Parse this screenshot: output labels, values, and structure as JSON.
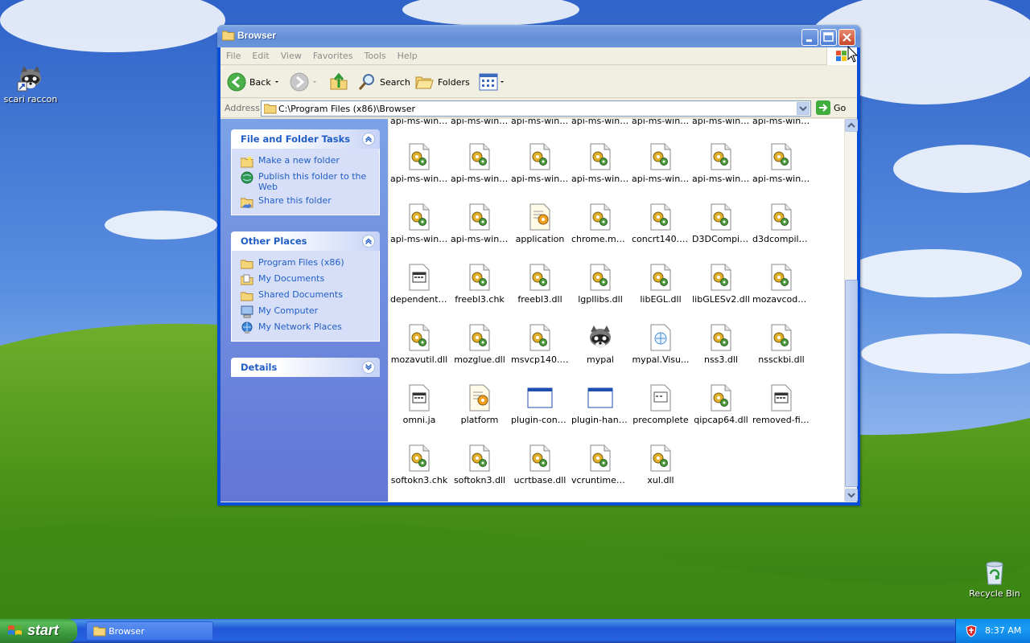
{
  "desktop": {
    "icons": [
      {
        "label": "scari raccon",
        "icon": "raccoon-shortcut-icon"
      },
      {
        "label": "Recycle Bin",
        "icon": "recycle-bin-icon"
      }
    ]
  },
  "window": {
    "title": "Browser",
    "menu": [
      "File",
      "Edit",
      "View",
      "Favorites",
      "Tools",
      "Help"
    ],
    "toolbar": {
      "back_label": "Back",
      "search_label": "Search",
      "folders_label": "Folders"
    },
    "address": {
      "label": "Address",
      "value": "C:\\Program Files (x86)\\Browser",
      "go_label": "Go"
    }
  },
  "taskpane": {
    "file_tasks": {
      "title": "File and Folder Tasks",
      "items": [
        {
          "label": "Make a new folder",
          "icon": "new-folder-icon"
        },
        {
          "label": "Publish this folder to the Web",
          "icon": "publish-web-icon"
        },
        {
          "label": "Share this folder",
          "icon": "share-folder-icon"
        }
      ]
    },
    "other_places": {
      "title": "Other Places",
      "items": [
        {
          "label": "Program Files (x86)",
          "icon": "folder-icon"
        },
        {
          "label": "My Documents",
          "icon": "my-documents-icon"
        },
        {
          "label": "Shared Documents",
          "icon": "shared-documents-icon"
        },
        {
          "label": "My Computer",
          "icon": "my-computer-icon"
        },
        {
          "label": "My Network Places",
          "icon": "network-places-icon"
        }
      ]
    },
    "details": {
      "title": "Details"
    }
  },
  "files": [
    {
      "name": "api-ms-win-...",
      "type": "partial"
    },
    {
      "name": "api-ms-win-...",
      "type": "partial"
    },
    {
      "name": "api-ms-win-...",
      "type": "partial"
    },
    {
      "name": "api-ms-win-...",
      "type": "partial"
    },
    {
      "name": "api-ms-win-...",
      "type": "partial"
    },
    {
      "name": "api-ms-win-...",
      "type": "partial"
    },
    {
      "name": "api-ms-win-...",
      "type": "partial"
    },
    {
      "name": "api-ms-win-...",
      "type": "dll"
    },
    {
      "name": "api-ms-win-...",
      "type": "dll"
    },
    {
      "name": "api-ms-win-...",
      "type": "dll"
    },
    {
      "name": "api-ms-win-...",
      "type": "dll"
    },
    {
      "name": "api-ms-win-...",
      "type": "dll"
    },
    {
      "name": "api-ms-win-...",
      "type": "dll"
    },
    {
      "name": "api-ms-win-...",
      "type": "dll"
    },
    {
      "name": "api-ms-win-...",
      "type": "dll"
    },
    {
      "name": "api-ms-win-...",
      "type": "dll"
    },
    {
      "name": "application",
      "type": "config"
    },
    {
      "name": "chrome.man...",
      "type": "dll"
    },
    {
      "name": "concrt140.dll",
      "type": "dll"
    },
    {
      "name": "D3DCompil...",
      "type": "dll"
    },
    {
      "name": "d3dcompiler...",
      "type": "dll"
    },
    {
      "name": "dependentli...",
      "type": "textfile"
    },
    {
      "name": "freebl3.chk",
      "type": "dll"
    },
    {
      "name": "freebl3.dll",
      "type": "dll"
    },
    {
      "name": "lgpllibs.dll",
      "type": "dll"
    },
    {
      "name": "libEGL.dll",
      "type": "dll"
    },
    {
      "name": "libGLESv2.dll",
      "type": "dll"
    },
    {
      "name": "mozavcodec...",
      "type": "dll"
    },
    {
      "name": "mozavutil.dll",
      "type": "dll"
    },
    {
      "name": "mozglue.dll",
      "type": "dll"
    },
    {
      "name": "msvcp140.dll",
      "type": "dll"
    },
    {
      "name": "mypal",
      "type": "raccoon"
    },
    {
      "name": "mypal.Visu...",
      "type": "manifest"
    },
    {
      "name": "nss3.dll",
      "type": "dll"
    },
    {
      "name": "nssckbi.dll",
      "type": "dll"
    },
    {
      "name": "omni.ja",
      "type": "textfile"
    },
    {
      "name": "platform",
      "type": "config"
    },
    {
      "name": "plugin-cont...",
      "type": "exe"
    },
    {
      "name": "plugin-hang-ui",
      "type": "exe"
    },
    {
      "name": "precomplete",
      "type": "doc"
    },
    {
      "name": "qipcap64.dll",
      "type": "dll"
    },
    {
      "name": "removed-files",
      "type": "textfile"
    },
    {
      "name": "softokn3.chk",
      "type": "dll"
    },
    {
      "name": "softokn3.dll",
      "type": "dll"
    },
    {
      "name": "ucrtbase.dll",
      "type": "dll"
    },
    {
      "name": "vcruntime1...",
      "type": "dll"
    },
    {
      "name": "xul.dll",
      "type": "dll"
    }
  ],
  "taskbar": {
    "start_label": "start",
    "task_label": "Browser",
    "clock": "8:37 AM"
  }
}
